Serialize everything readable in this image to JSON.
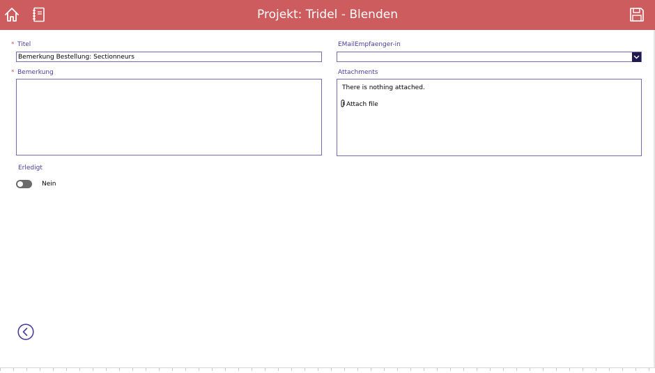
{
  "header": {
    "title": "Projekt: Tridel - Blenden",
    "home_icon": "home-icon",
    "notebook_icon": "notebook-icon",
    "save_icon": "save-icon",
    "background_color": "#cd5c5e"
  },
  "form": {
    "titel": {
      "required_mark": "*",
      "label": "Titel",
      "value": "Bemerkung Bestellung: Sectionneurs"
    },
    "email": {
      "label": "EMailEmpfaenger-in",
      "value": "",
      "dropdown_icon": "chevron-down-icon"
    },
    "bemerkung": {
      "required_mark": "*",
      "label": "Bemerkung",
      "value": ""
    },
    "attachments": {
      "label": "Attachments",
      "empty_text": "There is nothing attached.",
      "attach_label": "Attach file",
      "attach_icon": "paperclip-icon"
    },
    "erledigt": {
      "label": "Erledigt",
      "state_text": "Nein",
      "checked": false
    }
  },
  "footer": {
    "back_icon": "back-arrow-icon"
  },
  "colors": {
    "accent": "#4b3ca3",
    "border": "#7866b8",
    "required": "#c45b62",
    "dropdown_button": "#1f1b4f"
  }
}
